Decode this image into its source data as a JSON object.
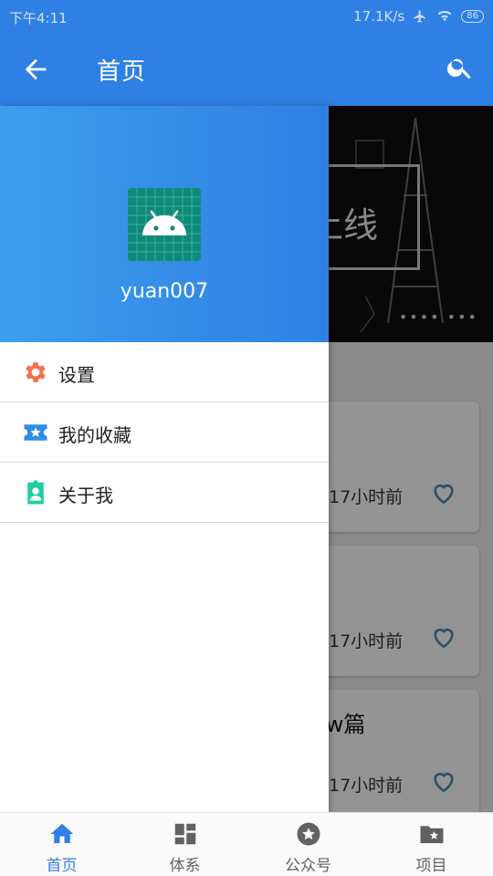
{
  "status_bar": {
    "time": "下午4:11",
    "network_speed": "17.1K/s",
    "battery": "86"
  },
  "app_bar": {
    "title": "首页"
  },
  "banner": {
    "text": "航上线"
  },
  "articles": [
    {
      "title": "",
      "time": "17小时前"
    },
    {
      "title": "",
      "time": "17小时前"
    },
    {
      "title": "ew篇",
      "time": "17小时前"
    }
  ],
  "drawer": {
    "username": "yuan007",
    "menu": [
      {
        "label": "设置",
        "icon": "gear-icon",
        "color": "#f2724e"
      },
      {
        "label": "我的收藏",
        "icon": "star-ticket-icon",
        "color": "#2f8ee6"
      },
      {
        "label": "关于我",
        "icon": "id-badge-icon",
        "color": "#1ecfa2"
      }
    ]
  },
  "bottom_nav": [
    {
      "label": "首页",
      "icon": "home-icon",
      "active": true
    },
    {
      "label": "体系",
      "icon": "dashboard-icon",
      "active": false
    },
    {
      "label": "公众号",
      "icon": "star-circle-icon",
      "active": false
    },
    {
      "label": "项目",
      "icon": "folder-star-icon",
      "active": false
    }
  ],
  "colors": {
    "primary": "#2f80e4",
    "accent_heart": "#4a8fb0"
  }
}
